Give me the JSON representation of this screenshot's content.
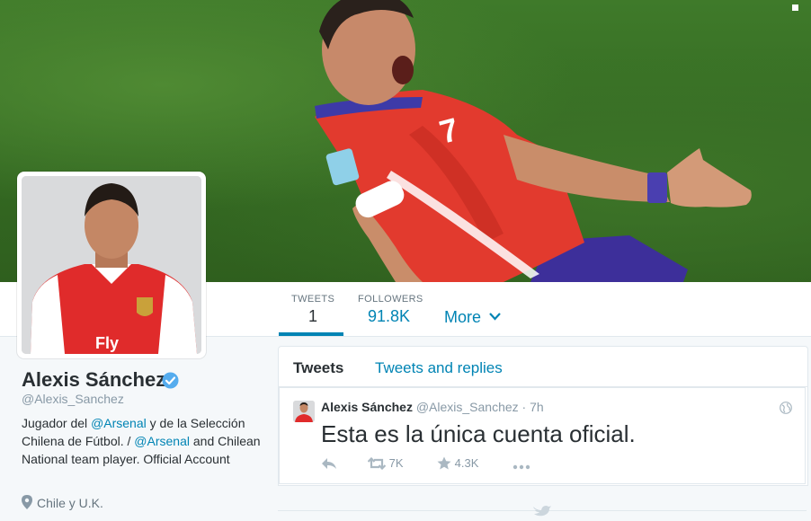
{
  "profile": {
    "name": "Alexis Sánchez",
    "handle": "@Alexis_Sanchez",
    "bio": {
      "p1": "Jugador del ",
      "link1": "@Arsenal",
      "p2": " y de la Selección Chilena de Fútbol. / ",
      "link2": "@Arsenal",
      "p3": " and Chilean National team player.   Official Account"
    },
    "location": "Chile y U.K.",
    "avatar_shirt_text": "Fly"
  },
  "nav": {
    "tweets_label": "TWEETS",
    "tweets_count": "1",
    "followers_label": "FOLLOWERS",
    "followers_count": "91.8K",
    "more_label": "More"
  },
  "timeline": {
    "tabs": [
      "Tweets",
      "Tweets and replies"
    ],
    "active_tab": "Tweets",
    "tweet": {
      "author_name": "Alexis Sánchez",
      "author_handle": "@Alexis_Sanchez",
      "time": "· 7h",
      "text": "Esta es la única cuenta oficial.",
      "retweets": "7K",
      "favorites": "4.3K"
    }
  },
  "colors": {
    "link_blue": "#0084b4",
    "verified_blue": "#55acee",
    "text_dark": "#292f33",
    "text_muted": "#8899a6",
    "banner_green": "#3a7427",
    "jersey_red": "#e23a2e"
  },
  "icons": [
    "verified-icon",
    "location-pin-icon",
    "chevron-down-icon",
    "globe-icon",
    "reply-icon",
    "retweet-icon",
    "favorite-star-icon",
    "more-dots-icon",
    "twitter-bird-icon"
  ]
}
